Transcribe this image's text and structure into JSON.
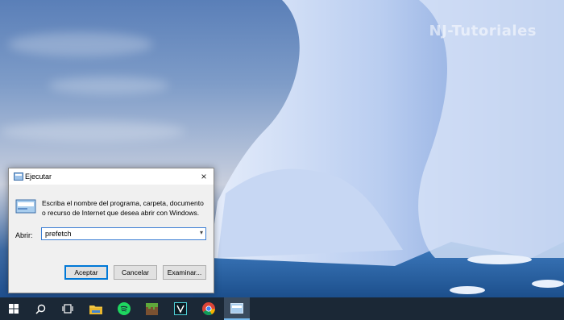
{
  "watermark": "NJ-Tutoriales",
  "dialog": {
    "title": "Ejecutar",
    "description": "Escriba el nombre del programa, carpeta, documento o recurso de Internet que desea abrir con Windows.",
    "open_label": "Abrir:",
    "open_value": "prefetch",
    "ok_label": "Aceptar",
    "cancel_label": "Cancelar",
    "browse_label": "Examinar...",
    "close_icon": "×"
  },
  "taskbar": {
    "items": [
      "start-icon",
      "search-icon",
      "task-view-icon",
      "file-explorer-icon",
      "spotify-icon",
      "minecraft-icon",
      "vegas-icon",
      "chrome-icon",
      "run-icon"
    ]
  },
  "colors": {
    "taskbar": "#1b2836",
    "accent": "#0078d7"
  }
}
